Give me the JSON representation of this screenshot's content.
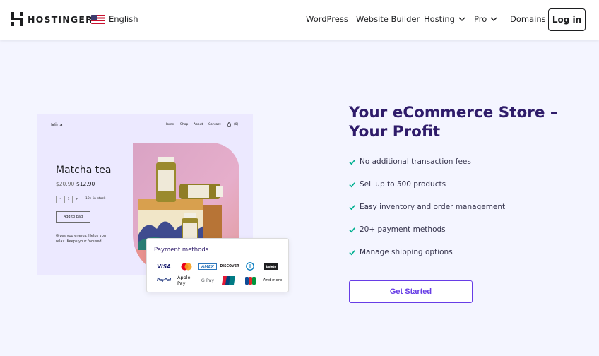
{
  "header": {
    "logo_text": "HOSTINGER",
    "language": "English",
    "nav": [
      {
        "label": "WordPress"
      },
      {
        "label": "Website Builder"
      },
      {
        "label": "Hosting"
      },
      {
        "label": "Pro"
      },
      {
        "label": "Domains"
      }
    ],
    "login_label": "Log in"
  },
  "mockup": {
    "brand": "Mina",
    "nav": [
      "Home",
      "Shop",
      "About",
      "Contact"
    ],
    "cart_count": "(0)",
    "product_title": "Matcha tea",
    "old_price": "$20.90",
    "price": "$12.90",
    "stepper": {
      "minus": "-",
      "qty": "1",
      "plus": "+"
    },
    "stock": "10+ in stock",
    "add_to_bag": "Add to bag",
    "description": "Gives you energy. Helps you relax. Keeps your focused."
  },
  "payment_card": {
    "title": "Payment methods",
    "logos": [
      "VISA",
      "Mastercard",
      "AMEX",
      "DISCOVER",
      "Diners Club",
      "boleto",
      "PayPal",
      "Apple Pay",
      "G Pay",
      "UnionPay",
      "JCB"
    ],
    "more": "And more"
  },
  "hero": {
    "title": "Your eCommerce Store – Your Profit",
    "features": [
      "No additional transaction fees",
      "Sell up to 500 products",
      "Easy inventory and order management",
      "20+ payment methods",
      "Manage shipping options"
    ],
    "cta_label": "Get Started"
  },
  "colors": {
    "brand_purple": "#673de6",
    "heading": "#2f1c6a",
    "check_green": "#00b090",
    "page_bg": "#f4f5ff"
  }
}
